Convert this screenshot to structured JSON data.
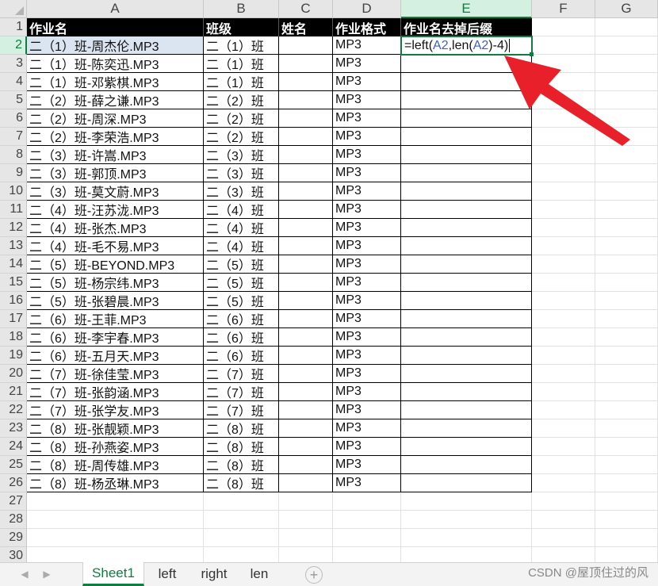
{
  "columns": [
    "A",
    "B",
    "C",
    "D",
    "E",
    "F",
    "G"
  ],
  "header_row": {
    "A": "作业名",
    "B": "班级",
    "C": "姓名",
    "D": "作业格式",
    "E": "作业名去掉后缀"
  },
  "rows": [
    {
      "n": "2",
      "a": "二（1）班-周杰伦.MP3",
      "b": "二（1）班",
      "d": "MP3"
    },
    {
      "n": "3",
      "a": "二（1）班-陈奕迅.MP3",
      "b": "二（1）班",
      "d": "MP3"
    },
    {
      "n": "4",
      "a": "二（1）班-邓紫棋.MP3",
      "b": "二（1）班",
      "d": "MP3"
    },
    {
      "n": "5",
      "a": "二（2）班-薛之谦.MP3",
      "b": "二（2）班",
      "d": "MP3"
    },
    {
      "n": "6",
      "a": "二（2）班-周深.MP3",
      "b": "二（2）班",
      "d": "MP3"
    },
    {
      "n": "7",
      "a": "二（2）班-李荣浩.MP3",
      "b": "二（2）班",
      "d": "MP3"
    },
    {
      "n": "8",
      "a": "二（3）班-许嵩.MP3",
      "b": "二（3）班",
      "d": "MP3"
    },
    {
      "n": "9",
      "a": "二（3）班-郭顶.MP3",
      "b": "二（3）班",
      "d": "MP3"
    },
    {
      "n": "10",
      "a": "二（3）班-莫文蔚.MP3",
      "b": "二（3）班",
      "d": "MP3"
    },
    {
      "n": "11",
      "a": "二（4）班-汪苏泷.MP3",
      "b": "二（4）班",
      "d": "MP3"
    },
    {
      "n": "12",
      "a": "二（4）班-张杰.MP3",
      "b": "二（4）班",
      "d": "MP3"
    },
    {
      "n": "13",
      "a": "二（4）班-毛不易.MP3",
      "b": "二（4）班",
      "d": "MP3"
    },
    {
      "n": "14",
      "a": "二（5）班-BEYOND.MP3",
      "b": "二（5）班",
      "d": "MP3"
    },
    {
      "n": "15",
      "a": "二（5）班-杨宗纬.MP3",
      "b": "二（5）班",
      "d": "MP3"
    },
    {
      "n": "16",
      "a": "二（5）班-张碧晨.MP3",
      "b": "二（5）班",
      "d": "MP3"
    },
    {
      "n": "17",
      "a": "二（6）班-王菲.MP3",
      "b": "二（6）班",
      "d": "MP3"
    },
    {
      "n": "18",
      "a": "二（6）班-李宇春.MP3",
      "b": "二（6）班",
      "d": "MP3"
    },
    {
      "n": "19",
      "a": "二（6）班-五月天.MP3",
      "b": "二（6）班",
      "d": "MP3"
    },
    {
      "n": "20",
      "a": "二（7）班-徐佳莹.MP3",
      "b": "二（7）班",
      "d": "MP3"
    },
    {
      "n": "21",
      "a": "二（7）班-张韵涵.MP3",
      "b": "二（7）班",
      "d": "MP3"
    },
    {
      "n": "22",
      "a": "二（7）班-张学友.MP3",
      "b": "二（7）班",
      "d": "MP3"
    },
    {
      "n": "23",
      "a": "二（8）班-张靓颖.MP3",
      "b": "二（8）班",
      "d": "MP3"
    },
    {
      "n": "24",
      "a": "二（8）班-孙燕姿.MP3",
      "b": "二（8）班",
      "d": "MP3"
    },
    {
      "n": "25",
      "a": "二（8）班-周传雄.MP3",
      "b": "二（8）班",
      "d": "MP3"
    },
    {
      "n": "26",
      "a": "二（8）班-杨丞琳.MP3",
      "b": "二（8）班",
      "d": "MP3"
    }
  ],
  "empty_rows": [
    "27",
    "28",
    "29",
    "30"
  ],
  "first_row_label": "1",
  "formula": {
    "prefix": "=left(",
    "ref1": "A2",
    "mid": ",len(",
    "ref2": "A2",
    "suffix": ")-4)"
  },
  "sheet_tabs": [
    "Sheet1",
    "left",
    "right",
    "len"
  ],
  "active_tab": "Sheet1",
  "watermark": "CSDN @屋顶住过的风",
  "colors": {
    "accent": "#107c41",
    "arrow": "#e8202a",
    "header_fill": "#000000",
    "selection_fill": "#dbe5f1"
  },
  "icons": {
    "prev_sheet": "triangle-left-icon",
    "next_sheet": "triangle-right-icon",
    "add_sheet": "plus-circle-icon",
    "annotation": "red-arrow"
  }
}
